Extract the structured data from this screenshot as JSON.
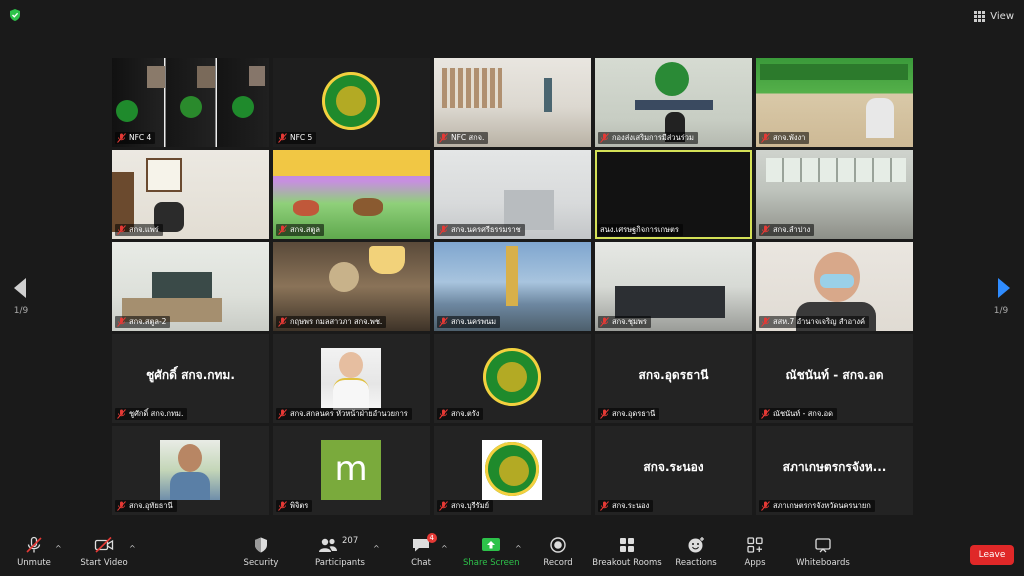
{
  "top": {
    "view_label": "View"
  },
  "pager": {
    "left_label": "1/9",
    "right_label": "1/9"
  },
  "participants": [
    {
      "name": "NFC 4"
    },
    {
      "name": "NFC 5"
    },
    {
      "name": "NFC สกจ."
    },
    {
      "name": "กองส่งเสริมการมีส่วนร่วม"
    },
    {
      "name": "สกจ.พังงา"
    },
    {
      "name": "สกจ.แพร่"
    },
    {
      "name": "สกจ.สตูล"
    },
    {
      "name": "สกจ.นครศรีธรรมราช"
    },
    {
      "name": "สนง.เศรษฐกิจการเกษตร"
    },
    {
      "name": "สกจ.ลำปาง"
    },
    {
      "name": "สกจ.สตูล-2"
    },
    {
      "name": "กฤษพร กมลสาวภา สกจ.พช."
    },
    {
      "name": "สกจ.นครพนม"
    },
    {
      "name": "สกจ.ชุมพร"
    },
    {
      "name": "สสห.7 อำนาจเจริญ สำอางค์"
    },
    {
      "name": "ชูศักดิ์ สกจ.กทม.",
      "big": "ชูศักดิ์ สกจ.กทม."
    },
    {
      "name": "สกจ.สกลนคร หัวหน้าฝ่ายอำนวยการ"
    },
    {
      "name": "สกจ.ตรัง"
    },
    {
      "name": "สกจ.อุดรธานี",
      "big": "สกจ.อุดรธานี"
    },
    {
      "name": "ณัชนันท์ - สกจ.อด",
      "big": "ณัชนันท์ - สกจ.อด"
    },
    {
      "name": "สกจ.อุทัยธานี"
    },
    {
      "name": "พิจิตร"
    },
    {
      "name": "สกจ.บุรีรัมย์"
    },
    {
      "name": "สกจ.ระนอง",
      "big": "สกจ.ระนอง"
    },
    {
      "name": "สภาเกษตรกรจังหวัดนครนายก",
      "big": "สภาเกษตรกรจังห..."
    }
  ],
  "toolbar": {
    "unmute": "Unmute",
    "start_video": "Start Video",
    "security": "Security",
    "participants": "Participants",
    "participants_count": "207",
    "chat": "Chat",
    "chat_badge": "4",
    "share_screen": "Share Screen",
    "record": "Record",
    "breakout_rooms": "Breakout Rooms",
    "reactions": "Reactions",
    "apps": "Apps",
    "whiteboards": "Whiteboards",
    "leave": "Leave"
  },
  "colors": {
    "accent_green": "#2dc24a",
    "active_speaker": "#d4e157",
    "leave_red": "#e02828",
    "arrow_blue": "#2f8cff"
  }
}
